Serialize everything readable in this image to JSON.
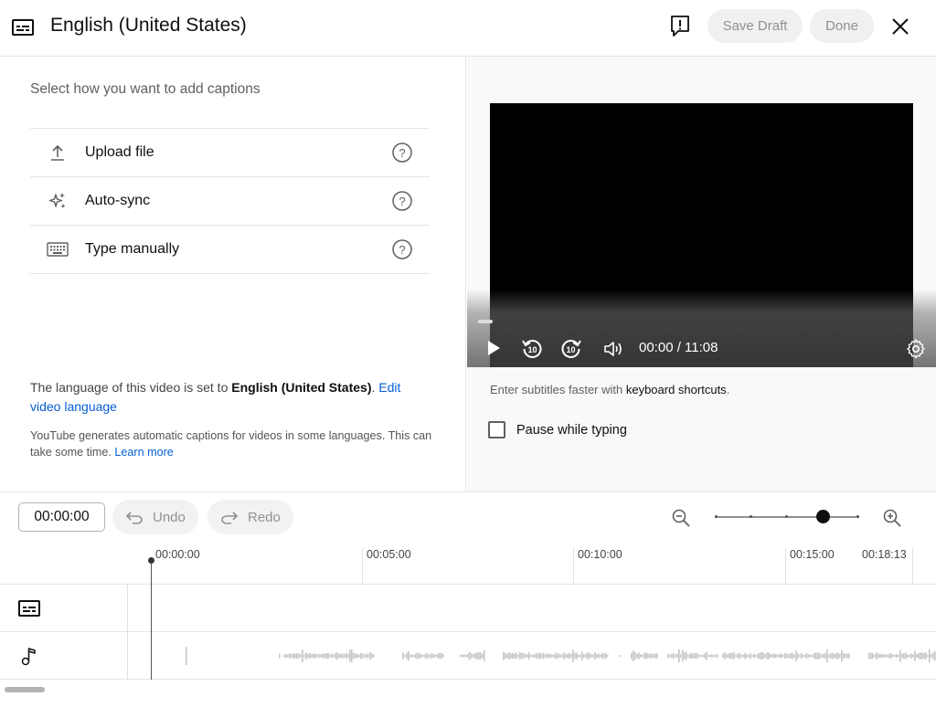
{
  "header": {
    "title": "English (United States)",
    "save_draft": "Save Draft",
    "done": "Done"
  },
  "left": {
    "prompt": "Select how you want to add captions",
    "options": [
      {
        "label": "Upload file",
        "icon": "upload-icon"
      },
      {
        "label": "Auto-sync",
        "icon": "sparkle-icon"
      },
      {
        "label": "Type manually",
        "icon": "keyboard-icon"
      }
    ],
    "lang_note_prefix": "The language of this video is set to ",
    "lang_note_lang": "English (United States)",
    "lang_note_suffix": ". ",
    "edit_language": "Edit video language",
    "auto_note": "YouTube generates automatic captions for videos in some languages. This can take some time. ",
    "learn_more": "Learn more"
  },
  "player": {
    "time": "00:00 / 11:08"
  },
  "right": {
    "kb_prefix": "Enter subtitles faster with ",
    "kb_link": "keyboard shortcuts",
    "kb_suffix": ".",
    "pause_label": "Pause while typing",
    "pause_checked": false
  },
  "timeline": {
    "timecode": "00:00:00",
    "undo": "Undo",
    "redo": "Redo",
    "zoom_level": 0.75,
    "ruler": [
      "00:00:00",
      "00:05:00",
      "00:10:00",
      "00:15:00",
      "00:18:13"
    ]
  }
}
